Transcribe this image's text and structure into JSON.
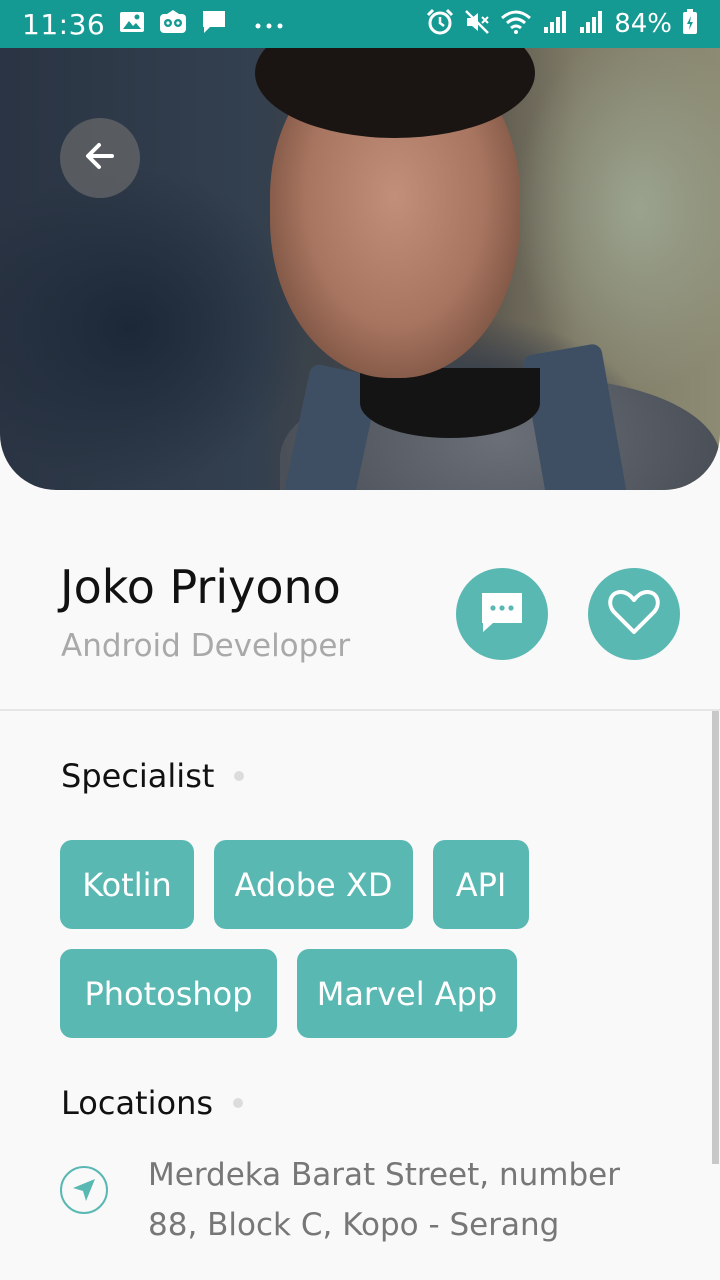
{
  "status_bar": {
    "time": "11:36",
    "battery": "84%",
    "left_icons": [
      "image-icon",
      "tripadvisor-icon",
      "chat-icon",
      "more-icon"
    ],
    "right_icons": [
      "alarm-icon",
      "mute-icon",
      "wifi-icon",
      "signal-icon",
      "signal-icon",
      "battery-icon"
    ],
    "color": "#159a93"
  },
  "profile": {
    "name": "Joko Priyono",
    "role": "Android Developer"
  },
  "actions": {
    "message_icon": "chat-bubble-icon",
    "favorite_icon": "heart-icon",
    "accent": "#5ab8b3"
  },
  "specialist": {
    "title": "Specialist",
    "skills": [
      "Kotlin",
      "Adobe XD",
      "API",
      "Photoshop",
      "Marvel App"
    ]
  },
  "locations": {
    "title": "Locations",
    "address": "Merdeka Barat Street, number 88, Block C, Kopo - Serang",
    "icon": "navigation-arrow-icon"
  }
}
